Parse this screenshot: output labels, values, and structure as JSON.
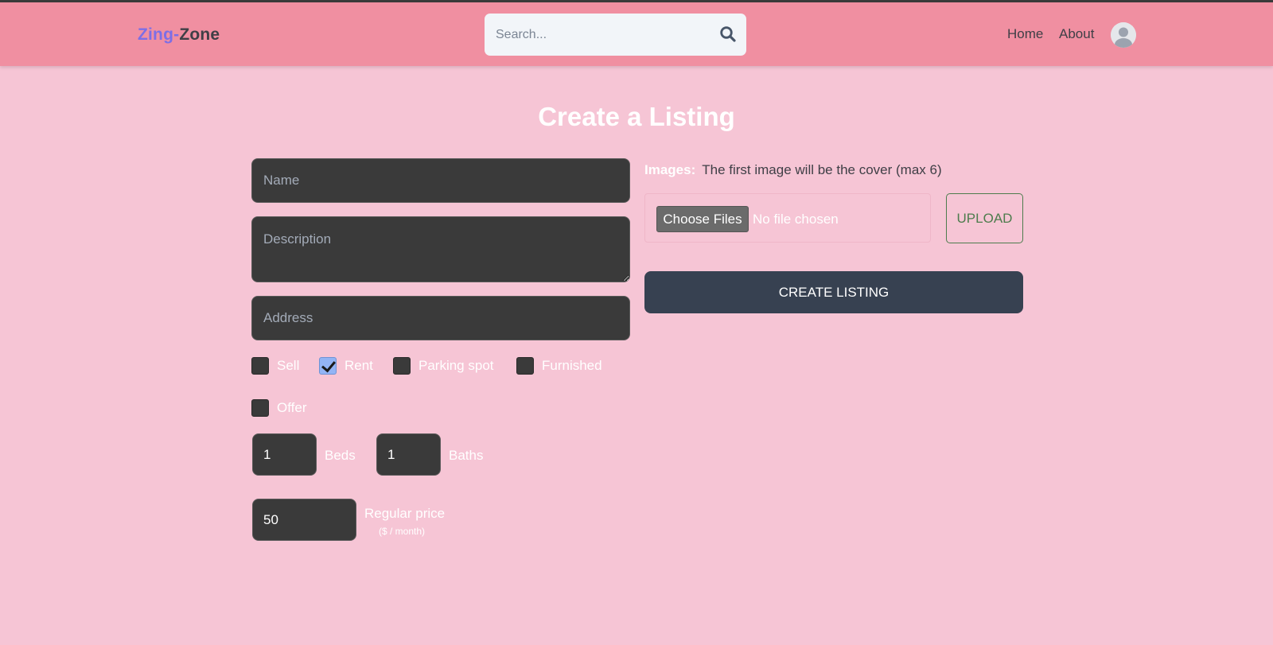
{
  "header": {
    "logo_part1": "Zing-",
    "logo_part2": "Zone",
    "search_placeholder": "Search...",
    "search_icon": "search-icon",
    "nav": [
      {
        "label": "Home"
      },
      {
        "label": "About"
      }
    ],
    "avatar_icon": "user-avatar-icon"
  },
  "page": {
    "title": "Create a Listing"
  },
  "form": {
    "name_placeholder": "Name",
    "description_placeholder": "Description",
    "address_placeholder": "Address",
    "checkboxes": [
      {
        "label": "Sell",
        "checked": false
      },
      {
        "label": "Rent",
        "checked": true
      },
      {
        "label": "Parking spot",
        "checked": false
      },
      {
        "label": "Furnished",
        "checked": false
      },
      {
        "label": "Offer",
        "checked": false
      }
    ],
    "beds": {
      "value": "1",
      "label": "Beds"
    },
    "baths": {
      "value": "1",
      "label": "Baths"
    },
    "regular_price": {
      "value": "50",
      "label": "Regular price",
      "sublabel": "($ / month)"
    }
  },
  "images": {
    "label": "Images:",
    "hint": "The first image will be the cover (max 6)",
    "choose_label": "Choose Files",
    "no_file_text": "No file chosen",
    "upload_label": "UPLOAD"
  },
  "submit": {
    "label": "CREATE LISTING"
  },
  "colors": {
    "background": "#f6c5d5",
    "header": "#f08fa1",
    "field": "#3a3a3a",
    "primary_button": "#374151",
    "upload_border": "#4d7c4d",
    "logo_accent": "#7c6ee6"
  }
}
